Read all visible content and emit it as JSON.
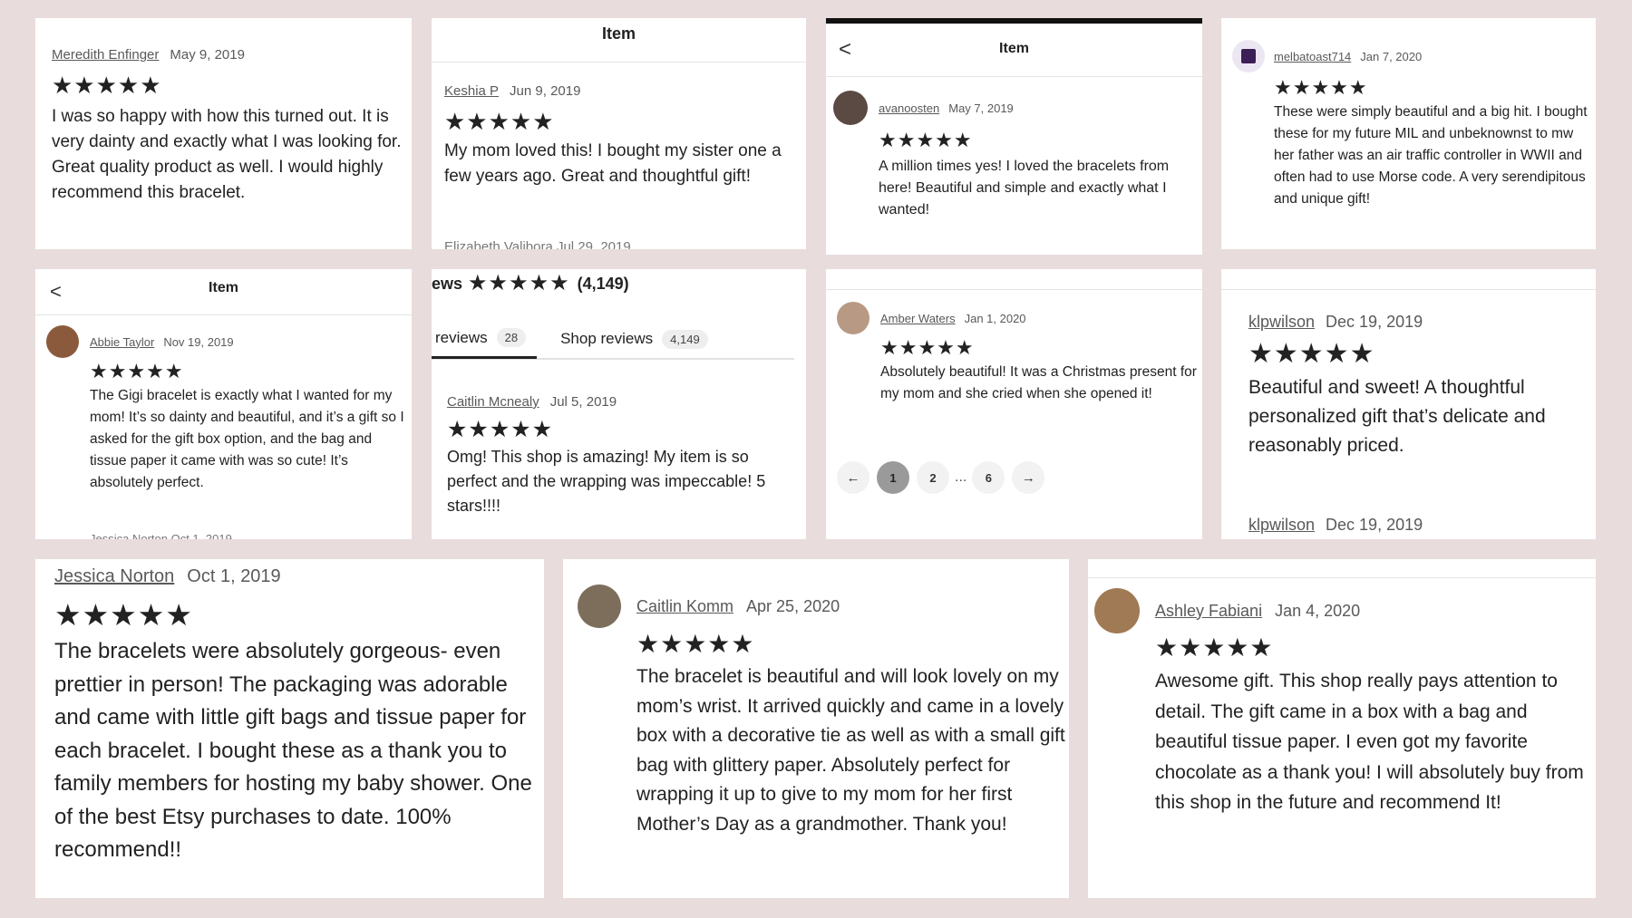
{
  "colors": {
    "background": "#e8dcdc",
    "card": "#ffffff",
    "text": "#222222",
    "meta": "#595959"
  },
  "icons": {
    "back": "chevron-left-icon",
    "star": "star-icon",
    "prev": "arrow-left-icon",
    "next": "arrow-right-icon"
  },
  "star_string": "★★★★★",
  "r1": {
    "name": "Meredith Enfinger",
    "date": "May 9, 2019",
    "rating": 5,
    "text": "I was so happy with how this turned out. It is very dainty and exactly what I was looking for. Great quality product as well. I would highly recommend this bracelet."
  },
  "r2": {
    "header": "Item",
    "name": "Keshia P",
    "date": "Jun 9, 2019",
    "rating": 5,
    "text": "My mom loved this! I bought my sister one a few years ago. Great and thoughtful gift!",
    "peek": "Elizabeth Valibora   Jul 29, 2019"
  },
  "r3": {
    "header": "Item",
    "back": "<",
    "name": "avanoosten",
    "date": "May 7, 2019",
    "rating": 5,
    "text": "A million times yes! I loved the bracelets from here! Beautiful and simple and exactly what I wanted!"
  },
  "r4": {
    "name": "melbatoast714",
    "date": "Jan 7, 2020",
    "rating": 5,
    "text": "These were simply beautiful and a big hit. I bought these for my future MIL and unbeknownst to mw her father was an air traffic controller in WWII and often had to use Morse code. A very serendipitous and unique gift!"
  },
  "r5": {
    "header": "Item",
    "back": "<",
    "name": "Abbie Taylor",
    "date": "Nov 19, 2019",
    "rating": 5,
    "text": "The Gigi bracelet is exactly what I wanted for my mom! It’s so dainty and beautiful, and it’s a gift so I asked for the gift box option, and the bag and tissue paper it came with was so cute! It’s absolutely perfect.",
    "peek": "Jessica Norton   Oct 1, 2019"
  },
  "r6": {
    "summary_label": "ews",
    "summary_count": "(4,149)",
    "tabs": [
      {
        "label": "reviews",
        "count": "28"
      },
      {
        "label": "Shop reviews",
        "count": "4,149"
      }
    ],
    "name": "Caitlin Mcnealy",
    "date": "Jul 5, 2019",
    "rating": 5,
    "text": "Omg! This shop is amazing! My item is so perfect and the wrapping was impeccable! 5 stars!!!!"
  },
  "r7": {
    "name": "Amber Waters",
    "date": "Jan 1, 2020",
    "rating": 5,
    "text": "Absolutely beautiful! It was a Christmas present for my mom and she cried when she opened it!",
    "pager": {
      "prev": "←",
      "pages": [
        "1",
        "2"
      ],
      "ellipsis": "...",
      "last": "6",
      "next": "→",
      "current": "1"
    }
  },
  "r8": {
    "name": "klpwilson",
    "date": "Dec 19, 2019",
    "rating": 5,
    "text": "Beautiful and sweet! A thoughtful personalized gift that’s delicate and reasonably priced.",
    "peek_name": "klpwilson",
    "peek_date": "Dec 19, 2019"
  },
  "r9": {
    "name": "Jessica Norton",
    "date": "Oct 1, 2019",
    "rating": 5,
    "text": "The bracelets were absolutely gorgeous- even prettier in person! The packaging was adorable and came with little gift bags and tissue paper for each bracelet. I bought these as a thank you to family members for hosting my baby shower. One of the best Etsy purchases to date. 100% recommend!!"
  },
  "r10": {
    "name": "Caitlin Komm",
    "date": "Apr 25, 2020",
    "rating": 5,
    "text": "The bracelet is beautiful and will look lovely on my mom’s wrist. It arrived quickly and came in a lovely box with a decorative tie as well as with a small gift bag with glittery paper. Absolutely perfect for wrapping it up to give to my mom for her first Mother’s Day as a grandmother. Thank you!"
  },
  "r11": {
    "name": "Ashley Fabiani",
    "date": "Jan 4, 2020",
    "rating": 5,
    "text": "Awesome gift. This shop really pays attention to detail. The gift came in a box with a bag and beautiful tissue paper. I even got my favorite chocolate as a thank you! I will absolutely buy from this shop in the future and recommend It!"
  }
}
